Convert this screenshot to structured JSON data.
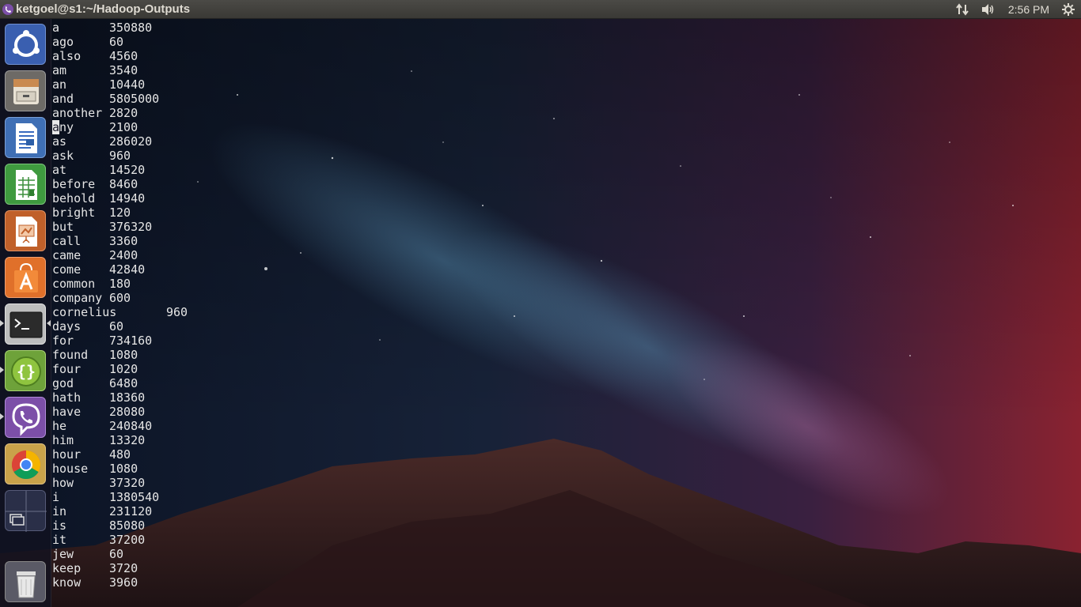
{
  "window_title": "ketgoel@s1:~/Hadoop-Outputs",
  "clock": "2:56 PM",
  "indicators": [
    "network-icon",
    "volume-icon",
    "gear-icon"
  ],
  "launcher": [
    {
      "name": "ubuntu-dash-button",
      "icon": "ubuntu-logo-icon"
    },
    {
      "name": "files-button",
      "icon": "file-cabinet-icon"
    },
    {
      "name": "libreoffice-writer-button",
      "icon": "writer-document-icon"
    },
    {
      "name": "libreoffice-calc-button",
      "icon": "calc-spreadsheet-icon"
    },
    {
      "name": "libreoffice-impress-button",
      "icon": "impress-presentation-icon"
    },
    {
      "name": "software-center-button",
      "icon": "shopping-bag-icon"
    },
    {
      "name": "terminal-button",
      "icon": "terminal-icon",
      "active": true
    },
    {
      "name": "brackets-editor-button",
      "icon": "braces-icon"
    },
    {
      "name": "viber-button",
      "icon": "viber-phone-icon"
    },
    {
      "name": "chrome-button",
      "icon": "chrome-icon"
    },
    {
      "name": "workspace-switcher-button",
      "icon": "workspace-grid-icon"
    },
    {
      "name": "trash-button",
      "icon": "trash-icon"
    }
  ],
  "terminal_output": [
    [
      "a",
      "350880"
    ],
    [
      "ago",
      "60"
    ],
    [
      "also",
      "4560"
    ],
    [
      "am",
      "3540"
    ],
    [
      "an",
      "10440"
    ],
    [
      "and",
      "5805000"
    ],
    [
      "another",
      "2820"
    ],
    [
      "any",
      "2100"
    ],
    [
      "as",
      "286020"
    ],
    [
      "ask",
      "960"
    ],
    [
      "at",
      "14520"
    ],
    [
      "before",
      "8460"
    ],
    [
      "behold",
      "14940"
    ],
    [
      "bright",
      "120"
    ],
    [
      "but",
      "376320"
    ],
    [
      "call",
      "3360"
    ],
    [
      "came",
      "2400"
    ],
    [
      "come",
      "42840"
    ],
    [
      "common",
      "180"
    ],
    [
      "company",
      "600"
    ],
    [
      "cornelius",
      "960"
    ],
    [
      "days",
      "60"
    ],
    [
      "for",
      "734160"
    ],
    [
      "found",
      "1080"
    ],
    [
      "four",
      "1020"
    ],
    [
      "god",
      "6480"
    ],
    [
      "hath",
      "18360"
    ],
    [
      "have",
      "28080"
    ],
    [
      "he",
      "240840"
    ],
    [
      "him",
      "13320"
    ],
    [
      "hour",
      "480"
    ],
    [
      "house",
      "1080"
    ],
    [
      "how",
      "37320"
    ],
    [
      "i",
      "1380540"
    ],
    [
      "in",
      "231120"
    ],
    [
      "is",
      "85080"
    ],
    [
      "it",
      "37200"
    ],
    [
      "jew",
      "60"
    ],
    [
      "keep",
      "3720"
    ],
    [
      "know",
      "3960"
    ]
  ],
  "cursor_row": 7,
  "colors": {
    "panel": "#3c3b37",
    "launcher": "#14142a",
    "text": "#e6e6e6"
  }
}
